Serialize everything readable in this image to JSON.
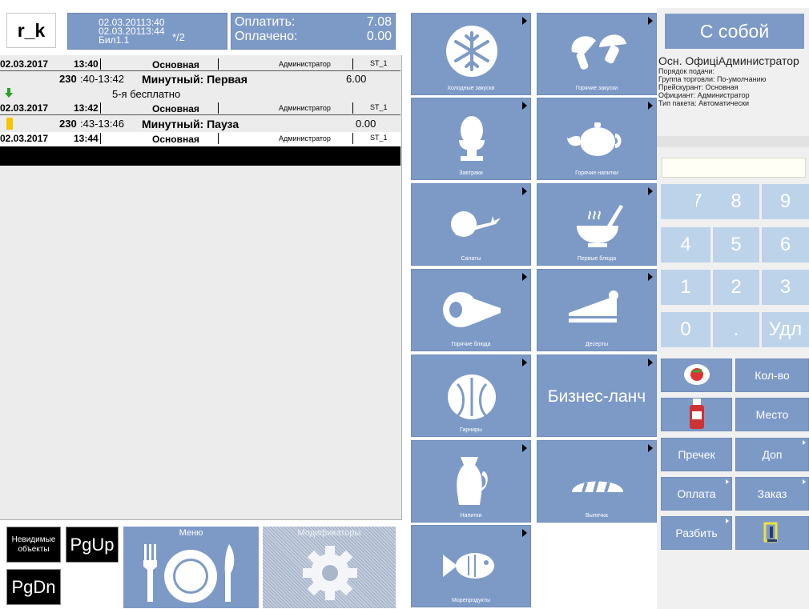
{
  "header": {
    "logo": "r_k",
    "check": {
      "line1": "02.03.20113:40",
      "line2": "02.03.20113:44",
      "line3": "Бил1.1",
      "guests": "*/2"
    },
    "payment": {
      "to_pay_label": "Оплатить:",
      "to_pay_value": "7.08",
      "paid_label": "Оплачено:",
      "paid_value": "0.00"
    }
  },
  "order": {
    "rows": [
      {
        "date": "02.03.2017",
        "time": "13:40",
        "section": "Основная",
        "waiter": "Администратор",
        "station": "ST_1"
      },
      {
        "date": "02.03.2017",
        "time": "13:42",
        "section": "Основная",
        "waiter": "Администратор",
        "station": "ST_1"
      },
      {
        "date": "02.03.2017",
        "time": "13:44",
        "section": "Основная",
        "waiter": "Администратор",
        "station": "ST_1"
      }
    ],
    "items": [
      {
        "code": "230",
        "period": ":40-13:42",
        "name": "Минутный: Первая",
        "price": "6.00"
      },
      {
        "code": "230",
        "period": ":43-13:46",
        "name": "Минутный: Пауза",
        "price": "0.00"
      }
    ],
    "note": "5-я бесплатно"
  },
  "bottom_left": {
    "invisible_objects": "Невидимые объекты",
    "pgup": "PgUp",
    "pgdn": "PgDn",
    "menu": "Меню",
    "modifiers": "Модификаторы"
  },
  "categories": [
    {
      "label": "Холодные закуски",
      "icon": "snowflake-icon"
    },
    {
      "label": "Горячие закуски",
      "icon": "mushroom-icon"
    },
    {
      "label": "Завтраки",
      "icon": "egg-icon"
    },
    {
      "label": "Горячие напитки",
      "icon": "teapot-icon"
    },
    {
      "label": "Салаты",
      "icon": "vegetables-icon"
    },
    {
      "label": "Первые блюда",
      "icon": "soup-bowl-icon"
    },
    {
      "label": "Горячие блюда",
      "icon": "ham-icon"
    },
    {
      "label": "Десерты",
      "icon": "cake-icon"
    },
    {
      "label": "Гарниры",
      "icon": "cabbage-icon"
    },
    {
      "label": "Бизнес-ланч",
      "icon": ""
    },
    {
      "label": "Напитки",
      "icon": "jug-icon"
    },
    {
      "label": "Выпечка",
      "icon": "bread-icon"
    },
    {
      "label": "Морепродукты",
      "icon": "fish-icon"
    }
  ],
  "right": {
    "to_go": "С собой",
    "info_main": "Осн. ОфиціАдминистратор",
    "info_lines": [
      "Порядок подачи:",
      "Группа торговли: По-умолчанию",
      "Прейскурант: Основная",
      "Официант: Администратор",
      "Тип пакета: Автоматически"
    ],
    "keypad": [
      "7",
      "8",
      "9",
      "4",
      "5",
      "6",
      "1",
      "2",
      "3",
      "0",
      ".",
      "Удл"
    ],
    "quantity": "Кол-во",
    "place": "Место",
    "precheck": "Пречек",
    "extra": "Доп",
    "payment": "Оплата",
    "order": "Заказ",
    "split": "Разбить"
  },
  "colors": {
    "tile": "#7d9ac7",
    "keypad": "#bdd3ea",
    "panel": "#ececec"
  }
}
